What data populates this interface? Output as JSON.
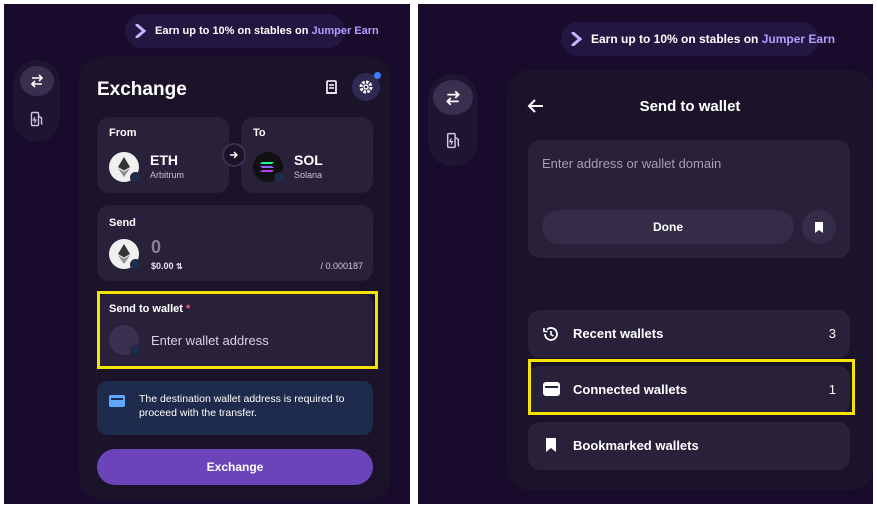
{
  "promo": {
    "text": "Earn up to 10% on stables on ",
    "link": "Jumper Earn"
  },
  "exchange": {
    "title": "Exchange",
    "from": {
      "label": "From",
      "token": "ETH",
      "chain": "Arbitrum"
    },
    "to": {
      "label": "To",
      "token": "SOL",
      "chain": "Solana"
    },
    "send": {
      "label": "Send",
      "amount": "0",
      "usd": "$0.00",
      "balance": "/ 0.000187"
    },
    "send_to_wallet": {
      "label": "Send to wallet",
      "required_mark": "*",
      "placeholder": "Enter wallet address"
    },
    "info": "The destination wallet address is required to proceed with the transfer.",
    "button": "Exchange"
  },
  "send_wallet": {
    "title": "Send to wallet",
    "input_placeholder": "Enter address or wallet domain",
    "done": "Done",
    "items": [
      {
        "label": "Recent wallets",
        "count": "3"
      },
      {
        "label": "Connected wallets",
        "count": "1"
      },
      {
        "label": "Bookmarked wallets",
        "count": ""
      }
    ]
  },
  "colors": {
    "background": "#180b2c",
    "card": "#1b1329",
    "box": "#292139",
    "accent": "#6a44b8",
    "highlight": "#f5e400",
    "link": "#b59cff"
  }
}
